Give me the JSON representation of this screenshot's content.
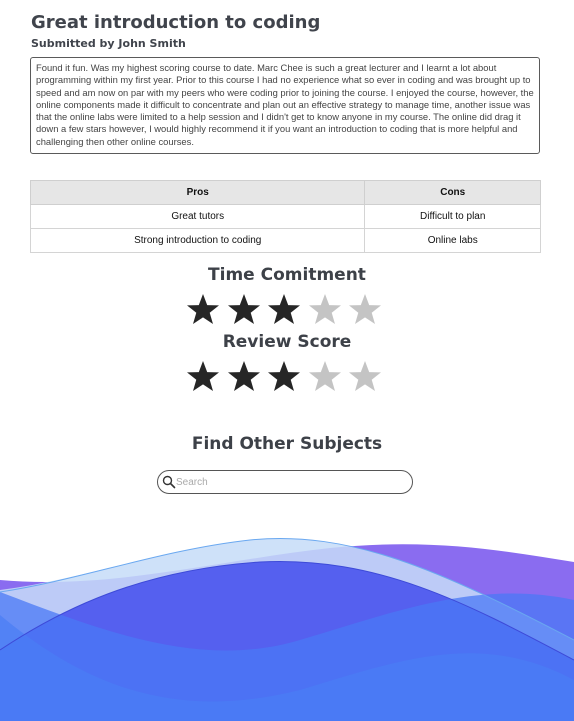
{
  "review": {
    "title": "Great introduction to coding",
    "submitted_by": "Submitted by John Smith",
    "body": "Found it fun. Was my highest scoring course to date. Marc Chee is such a great lecturer and I learnt a lot about programming within my first year. Prior to this course I had no experience what so ever in coding and was brought up to speed and am now on par with my peers who were coding prior to joining the course. I enjoyed the course, however, the online components made it difficult to concentrate and plan out an effective strategy to manage time, another issue was that the online labs were limited to a help session and I didn't get to know anyone in my course. The online did drag it down a few stars however, I would highly recommend it if you want an introduction to coding that is more helpful and challenging then other online courses."
  },
  "pros_cons": {
    "headers": [
      "Pros",
      "Cons"
    ],
    "rows": [
      [
        "Great tutors",
        "Difficult to plan"
      ],
      [
        "Strong introduction to coding",
        "Online labs"
      ]
    ]
  },
  "ratings": {
    "time_commitment": {
      "label": "Time Comitment",
      "value": 3,
      "max": 5
    },
    "review_score": {
      "label": "Review Score",
      "value": 3,
      "max": 5
    }
  },
  "find_other": {
    "heading": "Find Other Subjects",
    "search_placeholder": "Search",
    "search_value": ""
  },
  "colors": {
    "star_filled": "#262626",
    "star_empty": "#c4c4c4",
    "wave_purple": "#8a6cf0",
    "wave_blue": "#4a78f5",
    "wave_light": "#c9e0fa"
  },
  "icons": {
    "star": "star-icon",
    "search": "search-icon"
  }
}
